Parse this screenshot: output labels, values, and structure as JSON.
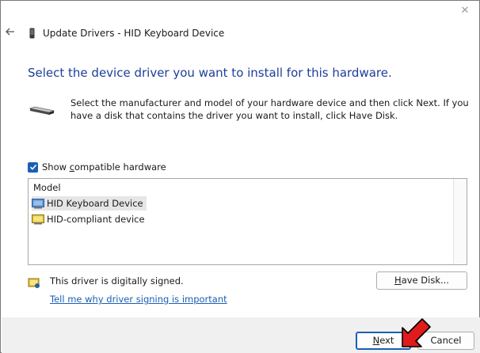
{
  "window": {
    "title": "Update Drivers - HID Keyboard Device",
    "close_glyph": "✕"
  },
  "heading": "Select the device driver you want to install for this hardware.",
  "intro": "Select the manufacturer and model of your hardware device and then click Next. If you have a disk that contains the driver you want to install, click Have Disk.",
  "show_compatible": {
    "label_pre": "Show ",
    "label_accel": "c",
    "label_post": "ompatible hardware",
    "checked": true
  },
  "model_list": {
    "header": "Model",
    "items": [
      {
        "label": "HID Keyboard Device",
        "selected": true,
        "icon": "keyboard-device-icon"
      },
      {
        "label": "HID-compliant device",
        "selected": false,
        "icon": "hid-device-icon"
      }
    ]
  },
  "signing": {
    "status": "This driver is digitally signed.",
    "link": "Tell me why driver signing is important"
  },
  "buttons": {
    "have_disk_accel": "H",
    "have_disk_rest": "ave Disk...",
    "next_accel": "N",
    "next_rest": "ext",
    "cancel": "Cancel"
  },
  "colors": {
    "heading": "#1c3f9a",
    "link": "#1a5fb4",
    "checkbox": "#1a5fb4",
    "pointer_arrow": "#e01b1b"
  }
}
